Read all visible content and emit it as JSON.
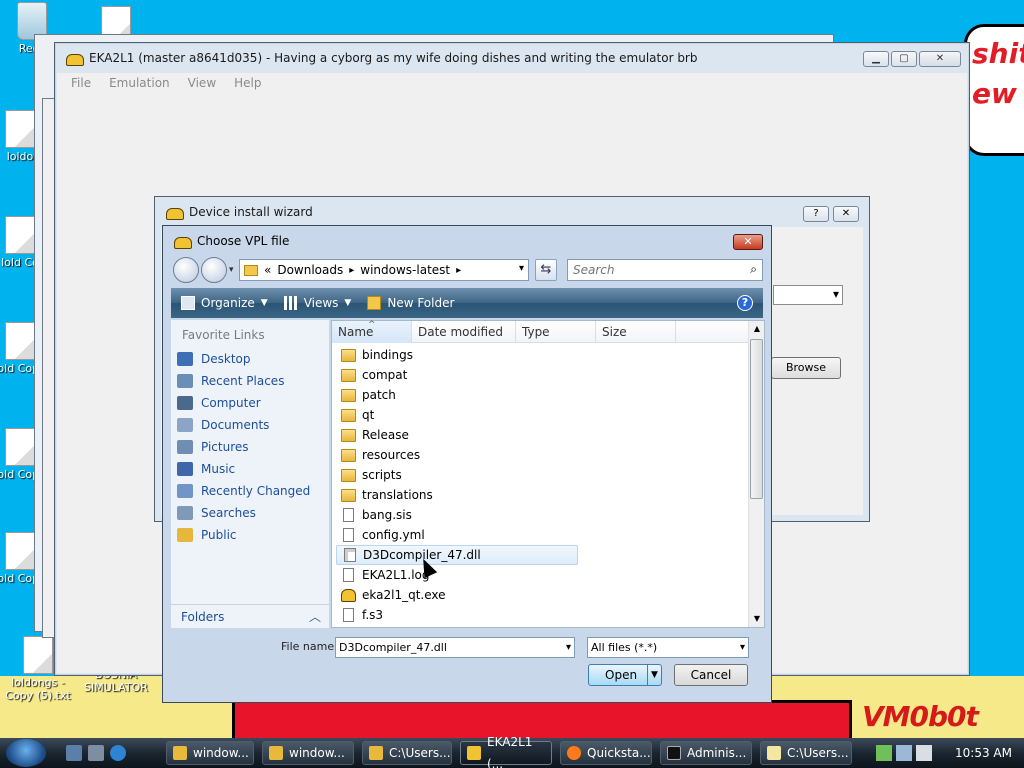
{
  "desktop": {
    "icons": [
      {
        "label": "Recy"
      },
      {
        "label": ""
      },
      {
        "label": "loldo"
      },
      {
        "label": "lold Co"
      },
      {
        "label": "lold Copy"
      },
      {
        "label": "lold Copy"
      },
      {
        "label": "lold Copy"
      },
      {
        "label": "loldongs - Copy (5).txt"
      },
      {
        "label": "BOSNIA SIMULATOR"
      }
    ],
    "speech_text": "shit ew",
    "watermark": "VM0b0t"
  },
  "main_window": {
    "title": "EKA2L1 (master a8641d035) - Having a cyborg as my wife doing dishes and writing the emulator brb",
    "menu": [
      "File",
      "Emulation",
      "View",
      "Help"
    ],
    "caption": {
      "minimize": "▁",
      "maximize": "▢",
      "close": "✕"
    }
  },
  "wizard": {
    "title": "Device install wizard",
    "help": "?",
    "close": "✕",
    "browse_label": "Browse"
  },
  "dialog": {
    "title": "Choose VPL file",
    "close": "✕",
    "address": {
      "prefix": "«",
      "segments": [
        "Downloads",
        "windows-latest"
      ]
    },
    "search_placeholder": "Search",
    "commands": [
      "Organize",
      "Views",
      "New Folder"
    ],
    "help": "?",
    "favorite_links_title": "Favorite Links",
    "favorite_links": [
      {
        "label": "Desktop",
        "icon": "desktop-icon",
        "color": "#3d6fb4"
      },
      {
        "label": "Recent Places",
        "icon": "recent-places-icon",
        "color": "#6a8fb6"
      },
      {
        "label": "Computer",
        "icon": "computer-icon",
        "color": "#4a6a8c"
      },
      {
        "label": "Documents",
        "icon": "documents-icon",
        "color": "#8aa6c4"
      },
      {
        "label": "Pictures",
        "icon": "pictures-icon",
        "color": "#6f8fb2"
      },
      {
        "label": "Music",
        "icon": "music-icon",
        "color": "#3f66a8"
      },
      {
        "label": "Recently Changed",
        "icon": "recently-changed-icon",
        "color": "#6f96c6"
      },
      {
        "label": "Searches",
        "icon": "searches-icon",
        "color": "#7f9ab6"
      },
      {
        "label": "Public",
        "icon": "public-folder-icon",
        "color": "#e7b63d"
      }
    ],
    "folders_label": "Folders",
    "columns": [
      "Name",
      "Date modified",
      "Type",
      "Size"
    ],
    "files": [
      {
        "name": "bindings",
        "kind": "folder"
      },
      {
        "name": "compat",
        "kind": "folder"
      },
      {
        "name": "patch",
        "kind": "folder"
      },
      {
        "name": "qt",
        "kind": "folder"
      },
      {
        "name": "Release",
        "kind": "folder"
      },
      {
        "name": "resources",
        "kind": "folder"
      },
      {
        "name": "scripts",
        "kind": "folder"
      },
      {
        "name": "translations",
        "kind": "folder"
      },
      {
        "name": "bang.sis",
        "kind": "file"
      },
      {
        "name": "config.yml",
        "kind": "file"
      },
      {
        "name": "D3Dcompiler_47.dll",
        "kind": "dll",
        "selected": true
      },
      {
        "name": "EKA2L1.log",
        "kind": "file"
      },
      {
        "name": "eka2l1_qt.exe",
        "kind": "exe"
      },
      {
        "name": "f.s3",
        "kind": "file"
      },
      {
        "name": "",
        "kind": "file"
      }
    ],
    "file_name_label": "File name:",
    "file_name_value": "D3Dcompiler_47.dll",
    "file_type_value": "All files (*.*)",
    "open_label": "Open",
    "cancel_label": "Cancel"
  },
  "taskbar": {
    "tasks": [
      {
        "label": "window...",
        "icon": "folder-icon",
        "active": false
      },
      {
        "label": "window...",
        "icon": "folder-icon",
        "active": false
      },
      {
        "label": "C:\\Users...",
        "icon": "folder-icon",
        "active": false
      },
      {
        "label": "EKA2L1 (...",
        "icon": "eka2l1-icon",
        "active": true
      },
      {
        "label": "Quicksta...",
        "icon": "firefox-icon",
        "active": false
      },
      {
        "label": "Adminis...",
        "icon": "cmd-icon",
        "active": false
      },
      {
        "label": "C:\\Users...",
        "icon": "notepad-icon",
        "active": false
      }
    ],
    "clock": "10:53 AM"
  }
}
